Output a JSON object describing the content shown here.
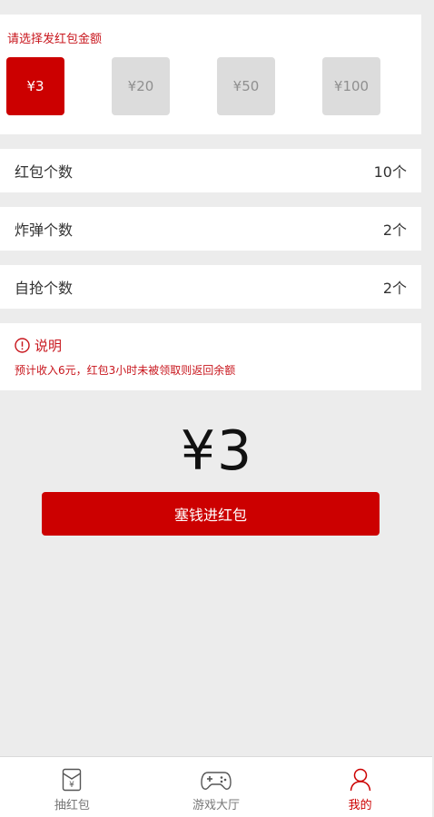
{
  "amount_picker": {
    "title": "请选择发红包金额",
    "options": [
      {
        "label": "¥3",
        "selected": true
      },
      {
        "label": "¥20",
        "selected": false
      },
      {
        "label": "¥50",
        "selected": false
      },
      {
        "label": "¥100",
        "selected": false
      }
    ]
  },
  "settings": {
    "packet_count": {
      "label": "红包个数",
      "value": "10个"
    },
    "bomb_count": {
      "label": "炸弹个数",
      "value": "2个"
    },
    "self_grab_count": {
      "label": "自抢个数",
      "value": "2个"
    }
  },
  "note": {
    "title": "说明",
    "text": "预计收入6元，红包3小时未被领取则返回余额"
  },
  "total": {
    "display": "¥3"
  },
  "submit": {
    "label": "塞钱进红包"
  },
  "tabbar": {
    "tabs": [
      {
        "label": "抽红包",
        "icon": "red-envelope-icon",
        "active": false
      },
      {
        "label": "游戏大厅",
        "icon": "gamepad-icon",
        "active": false
      },
      {
        "label": "我的",
        "icon": "user-icon",
        "active": true
      }
    ]
  },
  "colors": {
    "accent": "#cc0000",
    "note_text": "#c8161d",
    "option_inactive_bg": "#dcdcdc",
    "page_bg": "#ececec"
  }
}
